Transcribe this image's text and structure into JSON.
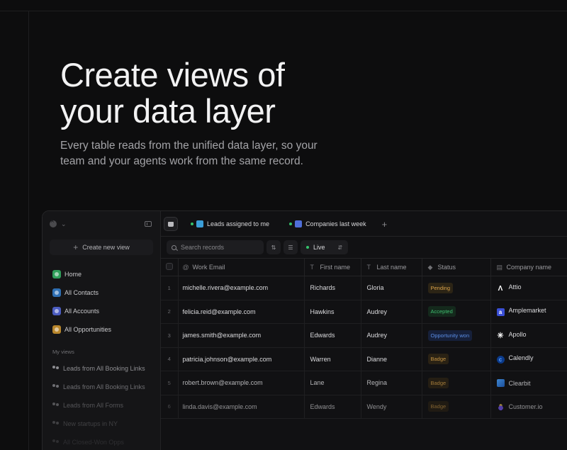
{
  "hero": {
    "title_line1": "Create views of",
    "title_line2": "your data layer",
    "subtitle": "Every table reads from the unified data layer, so your team and your agents work from the same record."
  },
  "sidebar": {
    "create_view_label": "Create new view",
    "items": [
      {
        "label": "Home",
        "icon": "home-icon",
        "color": "#2f9e5a"
      },
      {
        "label": "All Contacts",
        "icon": "contacts-icon",
        "color": "#2f6fb3"
      },
      {
        "label": "All Accounts",
        "icon": "accounts-icon",
        "color": "#4b5cc0"
      },
      {
        "label": "All Opportunities",
        "icon": "opportunities-icon",
        "color": "#b8862c"
      }
    ],
    "my_views_label": "My views",
    "views": [
      "Leads from All Booking Links",
      "Leads from All Booking Links",
      "Leads from All Forms",
      "New startups in NY",
      "All Closed-Won Opps"
    ]
  },
  "tabs": [
    {
      "label": "Leads assigned to me",
      "icon": "users-icon",
      "color": "#3b9ed8"
    },
    {
      "label": "Companies last week",
      "icon": "building-icon",
      "color": "#4f6fd8"
    }
  ],
  "toolbar": {
    "search_placeholder": "Search records",
    "live_label": "Live"
  },
  "table": {
    "columns": [
      "Work Email",
      "First name",
      "Last name",
      "Status",
      "Company name"
    ],
    "rows": [
      {
        "num": "1",
        "email": "michelle.rivera@example.com",
        "first": "Richards",
        "last": "Gloria",
        "status": "Pending",
        "company": "Attio"
      },
      {
        "num": "2",
        "email": "felicia.reid@example.com",
        "first": "Hawkins",
        "last": "Audrey",
        "status": "Accepted",
        "company": "Amplemarket"
      },
      {
        "num": "3",
        "email": "james.smith@example.com",
        "first": "Edwards",
        "last": "Audrey",
        "status": "Opportunity won",
        "company": "Apollo"
      },
      {
        "num": "4",
        "email": "patricia.johnson@example.com",
        "first": "Warren",
        "last": "Dianne",
        "status": "Badge",
        "company": "Calendly"
      },
      {
        "num": "5",
        "email": "robert.brown@example.com",
        "first": "Lane",
        "last": "Regina",
        "status": "Badge",
        "company": "Clearbit"
      },
      {
        "num": "6",
        "email": "linda.davis@example.com",
        "first": "Edwards",
        "last": "Wendy",
        "status": "Badge",
        "company": "Customer.io"
      }
    ]
  }
}
